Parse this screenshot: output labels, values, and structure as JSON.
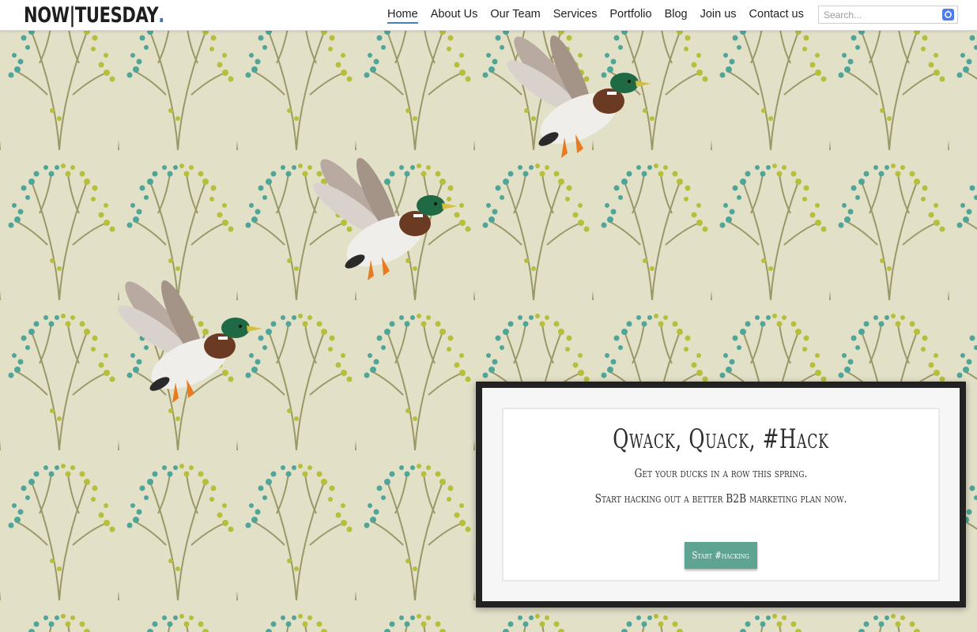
{
  "brand": {
    "name": "NOW|TUESDAY",
    "dot": "."
  },
  "nav": {
    "items": [
      "Home",
      "About Us",
      "Our Team",
      "Services",
      "Portfolio",
      "Blog",
      "Join us",
      "Contact us"
    ],
    "active": "Home"
  },
  "search": {
    "placeholder": "Search...",
    "icon": "search-submit-icon"
  },
  "hero": {
    "background": "wallpaper-pattern-branches",
    "birds": [
      "mallard-duck",
      "mallard-duck",
      "mallard-duck"
    ]
  },
  "card": {
    "title": "Qwack, Quack, #Hack",
    "line1": "Get your ducks in a row this spring.",
    "line2": "Start hacking out a better B2B marketing plan now.",
    "button": "Start #hacking"
  },
  "colors": {
    "accent": "#5fa393",
    "nav_underline": "#4a7fb8",
    "logo_dot": "#3b6fd4",
    "frame": "#222222",
    "wallpaper": "#e3e0c8",
    "leaf_teal": "#4ea598",
    "leaf_olive": "#b5bf3a"
  }
}
